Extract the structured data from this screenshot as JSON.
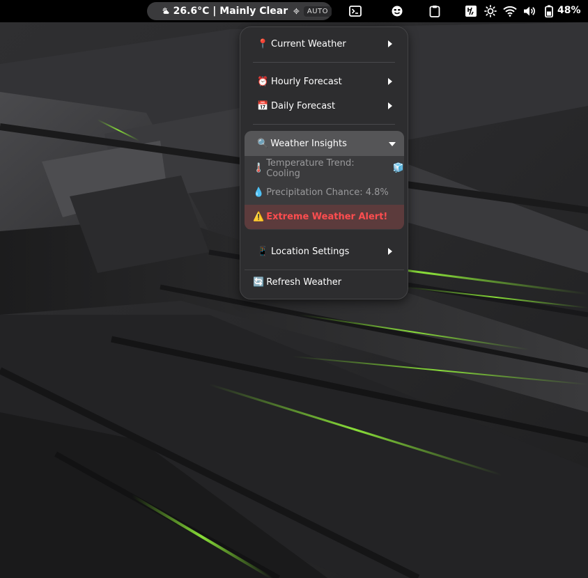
{
  "topbar": {
    "weather": {
      "text": "26.6°C | Mainly Clear",
      "auto_badge": "AUTO",
      "icon": "partly-sunny-icon",
      "location_icon": "location-crosshair-icon"
    },
    "tray_icons": [
      "terminal-icon",
      "emoji-face-icon",
      "clipboard-icon",
      "keyboard-layout-icon",
      "brightness-icon",
      "wifi-icon",
      "volume-icon",
      "battery-icon"
    ],
    "battery_percent": "48%"
  },
  "menu": {
    "current_weather": {
      "emoji": "📍",
      "label": "Current Weather"
    },
    "hourly_forecast": {
      "emoji": "⏰",
      "label": "Hourly Forecast"
    },
    "daily_forecast": {
      "emoji": "📅",
      "label": "Daily Forecast"
    },
    "weather_insights": {
      "emoji": "🔍",
      "label": "Weather Insights",
      "expanded": true,
      "items": [
        {
          "emoji": "🌡️",
          "label": "Temperature Trend: Cooling",
          "trail_emoji": "🧊"
        },
        {
          "emoji": "💧",
          "label": "Precipitation Chance: 4.8%"
        },
        {
          "emoji": "⚠️",
          "label": "Extreme Weather Alert!"
        }
      ]
    },
    "location_settings": {
      "emoji": "📱",
      "label": "Location Settings"
    },
    "refresh": {
      "emoji": "🔄",
      "label": "Refresh Weather"
    }
  },
  "colors": {
    "topbar_bg": "#000000",
    "menu_bg": "#2d2d2f",
    "insights_header_bg": "#555557",
    "alert_bg": "#5c3b3c",
    "alert_text": "#ff4d4f",
    "wallpaper_accent": "#7bd630"
  }
}
